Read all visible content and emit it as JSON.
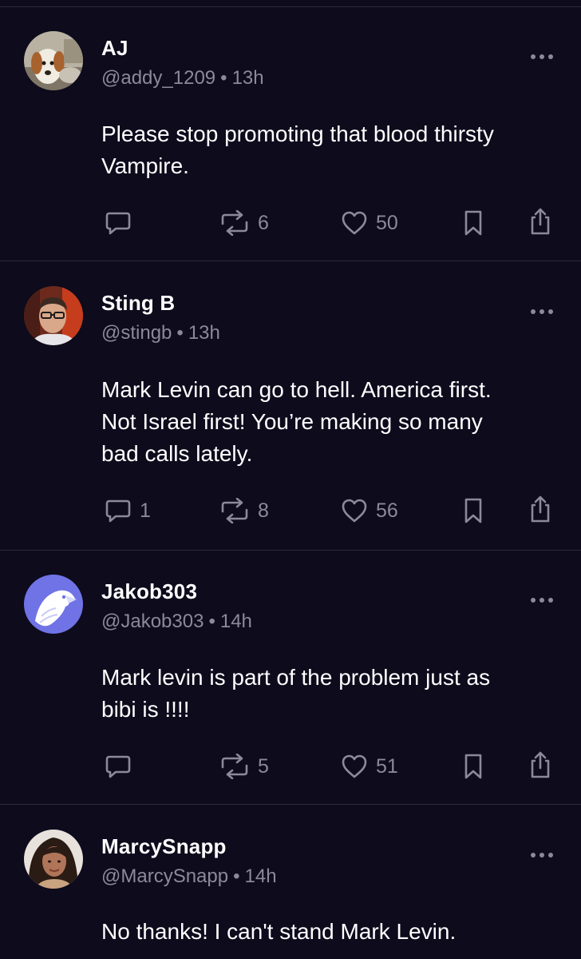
{
  "posts": [
    {
      "name": "AJ",
      "handle": "@addy_1209",
      "time": "13h",
      "body_lines": [
        "Please stop promoting that blood thirsty",
        "Vampire."
      ],
      "replies": "",
      "reposts": "6",
      "likes": "50",
      "avatar": "dog-photo"
    },
    {
      "name": "Sting B",
      "handle": "@stingb",
      "time": "13h",
      "body_lines": [
        "Mark Levin can go to hell. America first.",
        "Not Israel first! You’re making so many",
        "bad calls lately."
      ],
      "replies": "1",
      "reposts": "8",
      "likes": "56",
      "avatar": "man-with-glasses-photo"
    },
    {
      "name": "Jakob303",
      "handle": "@Jakob303",
      "time": "14h",
      "body_lines": [
        "Mark levin is part of the problem just as",
        "bibi is !!!!"
      ],
      "replies": "",
      "reposts": "5",
      "likes": "51",
      "avatar": "eagle-logo"
    },
    {
      "name": "MarcySnapp",
      "handle": "@MarcySnapp",
      "time": "14h",
      "body_lines": [
        "No thanks! I can't stand Mark Levin."
      ],
      "avatar": "woman-photo"
    }
  ],
  "separator": "•",
  "icons": {
    "reply": "reply-icon",
    "repost": "repost-icon",
    "like": "heart-icon",
    "bookmark": "bookmark-icon",
    "share": "share-icon",
    "more": "more-options-icon"
  },
  "colors": {
    "background": "#0d0b1c",
    "muted": "#8c8a99",
    "divider": "#2b2a3c",
    "text": "#ffffff"
  }
}
